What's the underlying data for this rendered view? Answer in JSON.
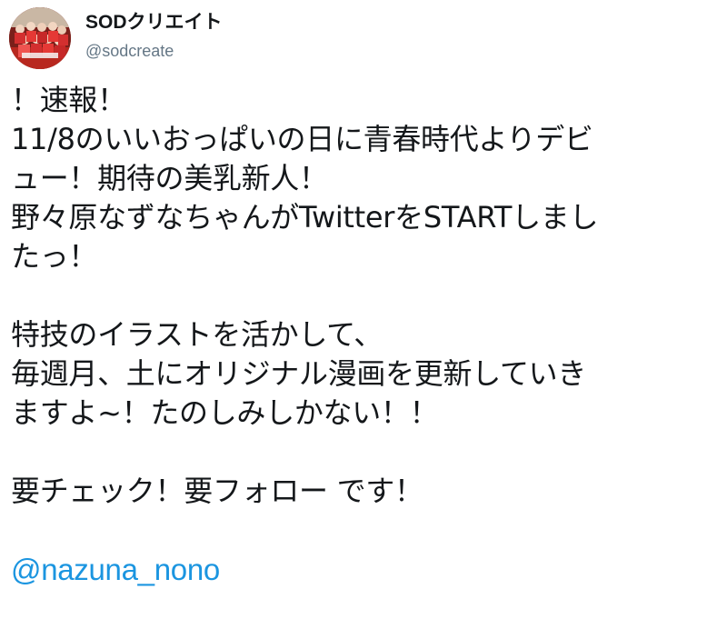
{
  "tweet": {
    "author": {
      "display_name": "SODクリエイト",
      "handle": "@sodcreate",
      "avatar_icon": "group-photo-avatar"
    },
    "lines": [
      "！速報！",
      "11/8のいいおっぱいの日に青春時代よりデビ",
      "ュー！期待の美乳新人！",
      "野々原なずなちゃんがTwitterをSTARTしまし",
      "たっ！",
      "",
      "特技のイラストを活かして、",
      "毎週月、土にオリジナル漫画を更新していき",
      "ますよ~！たのしみしかない！！",
      "",
      "要チェック！要フォロー です！"
    ],
    "mention": "@nazuna_nono"
  },
  "colors": {
    "text": "#14171a",
    "secondary": "#657786",
    "link": "#1b95e0"
  }
}
